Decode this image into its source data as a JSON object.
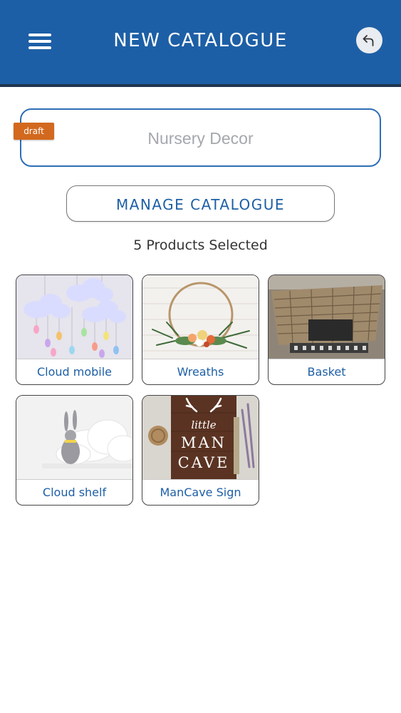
{
  "header": {
    "title": "NEW CATALOGUE",
    "menu_icon": "hamburger-menu-icon",
    "back_icon": "back-arrow-icon"
  },
  "catalogue": {
    "name_placeholder": "Nursery Decor",
    "status_badge": "draft"
  },
  "manage_button": {
    "label": "MANAGE CATALOGUE"
  },
  "selected_count": "5 Products Selected",
  "products": [
    {
      "name": "Cloud mobile"
    },
    {
      "name": "Wreaths"
    },
    {
      "name": "Basket"
    },
    {
      "name": "Cloud shelf"
    },
    {
      "name": "ManCave Sign"
    }
  ],
  "sign_text": {
    "line1": "little",
    "line2": "MAN",
    "line3": "CAVE"
  },
  "colors": {
    "header_bg": "#1d5fa6",
    "accent": "#1d5fa6",
    "draft_badge": "#d2691e"
  }
}
